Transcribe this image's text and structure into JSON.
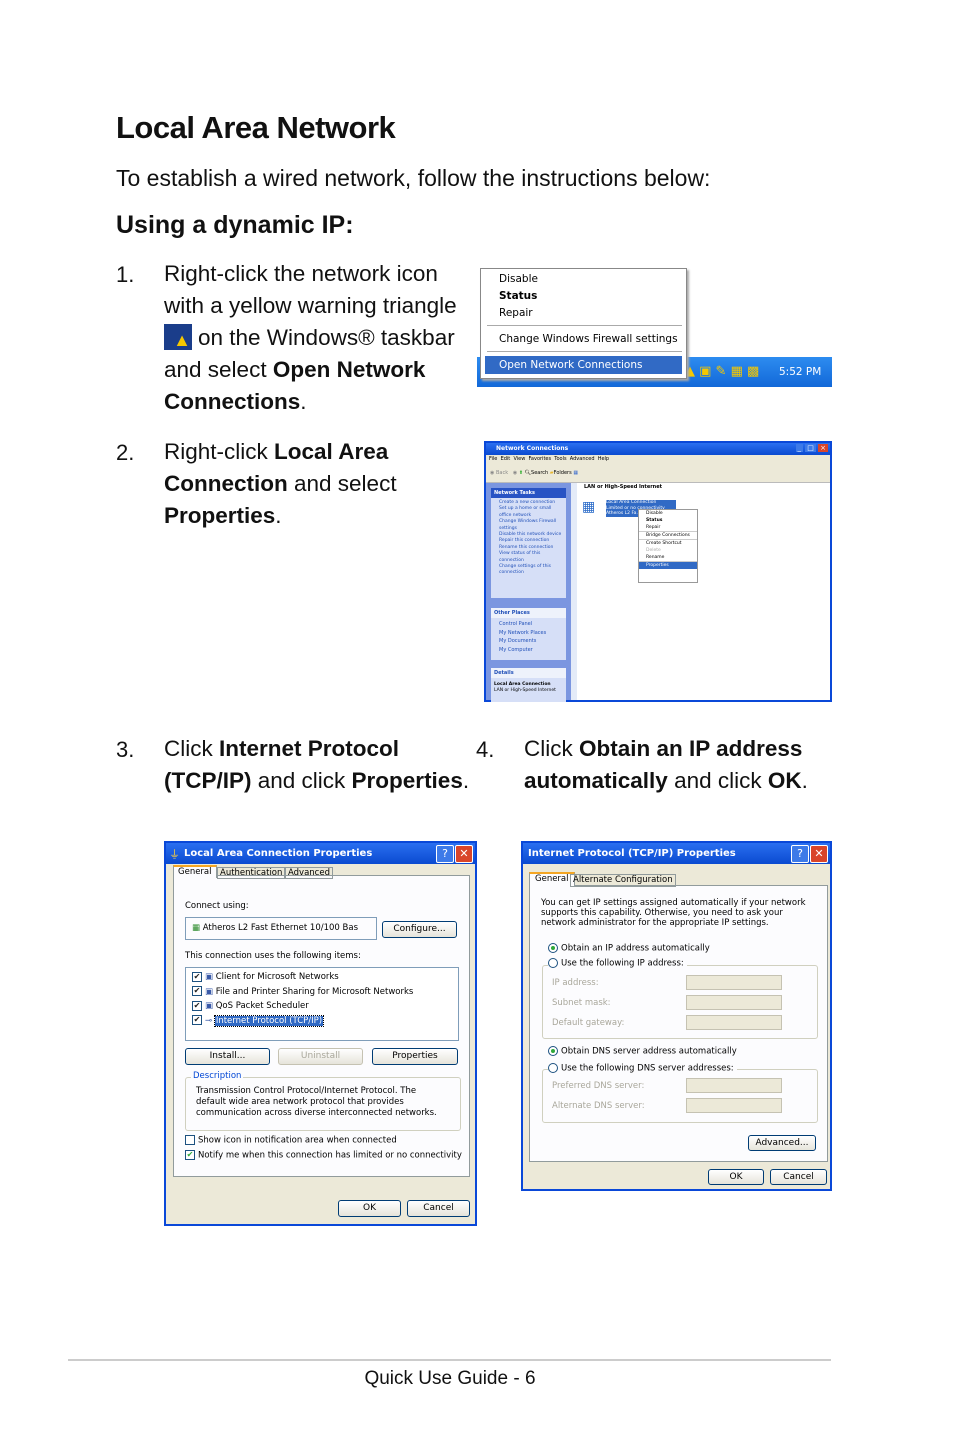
{
  "title": "Local Area Network",
  "intro": "To establish a wired network, follow the instructions below:",
  "subtitle": "Using a dynamic IP:",
  "steps": [
    {
      "number": "1.",
      "parts": [
        "Right-click the network icon with a yellow warning triangle ",
        "on the Windows® taskbar and select ",
        "Open Network Connections",
        "."
      ]
    },
    {
      "number": "2.",
      "parts": [
        "Right-click ",
        "Local Area Connection",
        " and select ",
        "Properties",
        "."
      ]
    },
    {
      "number": "3.",
      "parts": [
        "Click ",
        "Internet Protocol (TCP/IP)",
        " and click ",
        "Properties",
        "."
      ]
    },
    {
      "number": "4.",
      "parts": [
        "Click ",
        "Obtain an IP address automatically",
        " and click ",
        "OK",
        "."
      ]
    }
  ],
  "tray_menu": {
    "items": [
      "Disable",
      "Status",
      "Repair",
      "Change Windows Firewall settings",
      "Open Network Connections"
    ],
    "time": "5:52 PM"
  },
  "network_connections": {
    "title": "Network Connections",
    "menu": [
      "File",
      "Edit",
      "View",
      "Favorites",
      "Tools",
      "Advanced",
      "Help"
    ],
    "toolbar": [
      "Back",
      "Search",
      "Folders"
    ],
    "section": "LAN or High-Speed Internet",
    "connection": [
      "Local Area Connection",
      "Limited or no connectivity",
      "Atheros L2 Fa..."
    ],
    "context_menu": [
      "Disable",
      "Status",
      "Repair",
      "Bridge Connections",
      "Create Shortcut",
      "Delete",
      "Rename",
      "Properties"
    ],
    "network_tasks_title": "Network Tasks",
    "network_tasks": [
      "Create a new connection",
      "Set up a home or small office network",
      "Change Windows Firewall settings",
      "Disable this network device",
      "Repair this connection",
      "Rename this connection",
      "View status of this connection",
      "Change settings of this connection"
    ],
    "other_places_title": "Other Places",
    "other_places": [
      "Control Panel",
      "My Network Places",
      "My Documents",
      "My Computer"
    ],
    "details_title": "Details",
    "details": [
      "Local Area Connection",
      "LAN or High-Speed Internet"
    ]
  },
  "lan_properties": {
    "title": "Local Area Connection Properties",
    "tabs": [
      "General",
      "Authentication",
      "Advanced"
    ],
    "connect_using_label": "Connect using:",
    "adapter": "Atheros L2 Fast Ethernet 10/100 Bas",
    "configure": "Configure...",
    "items_label": "This connection uses the following items:",
    "items": [
      {
        "label": "Client for Microsoft Networks",
        "checked": true
      },
      {
        "label": "File and Printer Sharing for Microsoft Networks",
        "checked": true
      },
      {
        "label": "QoS Packet Scheduler",
        "checked": true
      },
      {
        "label": "Internet Protocol (TCP/IP)",
        "checked": true,
        "selected": true
      }
    ],
    "install": "Install...",
    "uninstall": "Uninstall",
    "properties": "Properties",
    "description_label": "Description",
    "description": "Transmission Control Protocol/Internet Protocol. The default wide area network protocol that provides communication across diverse interconnected networks.",
    "show_icon": "Show icon in notification area when connected",
    "notify": "Notify me when this connection has limited or no connectivity",
    "ok": "OK",
    "cancel": "Cancel"
  },
  "tcpip_properties": {
    "title": "Internet Protocol (TCP/IP) Properties",
    "tabs": [
      "General",
      "Alternate Configuration"
    ],
    "info": "You can get IP settings assigned automatically if your network supports this capability. Otherwise, you need to ask your network administrator for the appropriate IP settings.",
    "obtain_ip": "Obtain an IP address automatically",
    "use_ip": "Use the following IP address:",
    "ip_address": "IP address:",
    "subnet": "Subnet mask:",
    "gateway": "Default gateway:",
    "obtain_dns": "Obtain DNS server address automatically",
    "use_dns": "Use the following DNS server addresses:",
    "preferred_dns": "Preferred DNS server:",
    "alternate_dns": "Alternate DNS server:",
    "advanced": "Advanced...",
    "ok": "OK",
    "cancel": "Cancel"
  },
  "footer": "Quick Use Guide - 6"
}
